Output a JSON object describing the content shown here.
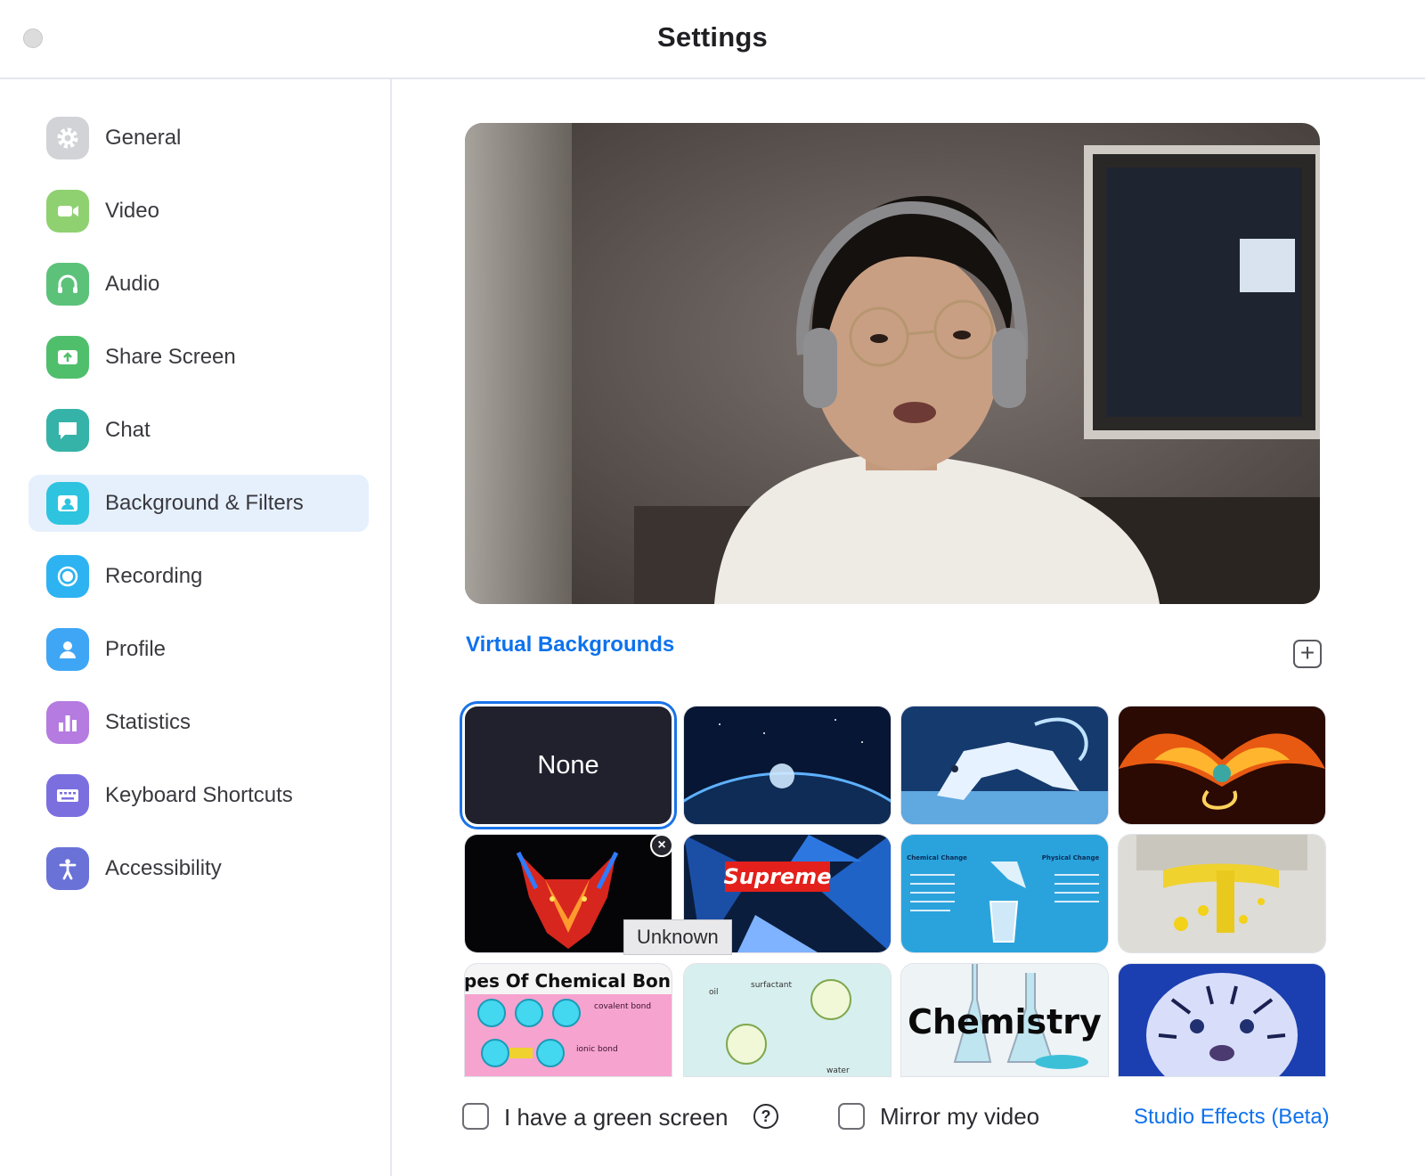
{
  "window": {
    "title": "Settings"
  },
  "sidebar": {
    "items": [
      {
        "label": "General",
        "icon": "gear-icon",
        "color": "#d2d3d7"
      },
      {
        "label": "Video",
        "icon": "video-camera-icon",
        "color": "#8fd170"
      },
      {
        "label": "Audio",
        "icon": "headphones-icon",
        "color": "#5cc27a"
      },
      {
        "label": "Share Screen",
        "icon": "share-screen-icon",
        "color": "#4fbf6c"
      },
      {
        "label": "Chat",
        "icon": "chat-bubble-icon",
        "color": "#36b3a8"
      },
      {
        "label": "Background & Filters",
        "icon": "background-person-icon",
        "color": "#2ec4e0",
        "selected": true
      },
      {
        "label": "Recording",
        "icon": "record-icon",
        "color": "#2db3f2"
      },
      {
        "label": "Profile",
        "icon": "person-icon",
        "color": "#3fa6f5"
      },
      {
        "label": "Statistics",
        "icon": "bar-chart-icon",
        "color": "#b57be0"
      },
      {
        "label": "Keyboard Shortcuts",
        "icon": "keyboard-icon",
        "color": "#7b6fe0"
      },
      {
        "label": "Accessibility",
        "icon": "accessibility-icon",
        "color": "#6a72d8"
      }
    ]
  },
  "main": {
    "virtual_backgrounds_title": "Virtual Backgrounds",
    "none_label": "None",
    "thumbnails": [
      {
        "name": "none",
        "selected": true
      },
      {
        "name": "earth-from-space"
      },
      {
        "name": "ice-tiger"
      },
      {
        "name": "fire-phoenix"
      },
      {
        "name": "neon-wolf"
      },
      {
        "name": "supreme",
        "text": "Supreme"
      },
      {
        "name": "chemical-vs-physical-change",
        "text_left": "Chemical Change",
        "text_right": "Physical Change"
      },
      {
        "name": "yellow-oil-bubbles"
      },
      {
        "name": "types-of-chemical-bonds",
        "text": "Types Of Chemical Bonds",
        "text_small_1": "covalent bond",
        "text_small_2": "ionic bond"
      },
      {
        "name": "micelles-diagram",
        "text_small_1": "oil",
        "text_small_2": "surfactant",
        "text_small_3": "water"
      },
      {
        "name": "chemistry-lab",
        "text": "Chemistry"
      },
      {
        "name": "white-tiger-cub"
      }
    ],
    "tooltip": "Unknown",
    "green_screen_label": "I have a green screen",
    "green_screen_checked": false,
    "mirror_label": "Mirror my video",
    "mirror_checked": false,
    "studio_effects_label": "Studio Effects (Beta)",
    "help_symbol": "?",
    "add_symbol": "+",
    "close_symbol": "×"
  }
}
